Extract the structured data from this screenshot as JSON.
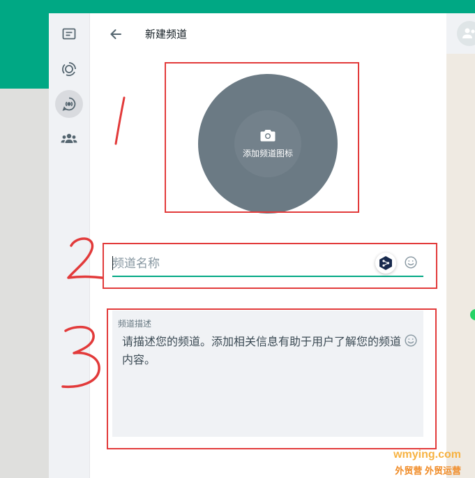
{
  "panel": {
    "title": "新建频道",
    "back_icon": "arrow-left-icon"
  },
  "rail": {
    "items": [
      {
        "name": "chats",
        "icon": "message-square-icon",
        "active": false
      },
      {
        "name": "status",
        "icon": "status-ring-icon",
        "active": false
      },
      {
        "name": "channels",
        "icon": "channel-icon",
        "active": true
      },
      {
        "name": "communities",
        "icon": "people-group-icon",
        "active": false
      }
    ]
  },
  "channel_icon": {
    "label": "添加频道图标",
    "icon": "camera-icon"
  },
  "name_field": {
    "placeholder": "频道名称",
    "value": ""
  },
  "description": {
    "label": "频道描述",
    "placeholder": "请描述您的频道。添加相关信息有助于用户了解您的频道内容。"
  },
  "annotations": {
    "marker_1": "1",
    "marker_2": "2",
    "marker_3": "3"
  },
  "watermark": {
    "domain": "wmying.com",
    "tagline": "外贸营 外贸运营"
  },
  "colors": {
    "brand": "#00a884",
    "annotation": "#e23a3a"
  }
}
